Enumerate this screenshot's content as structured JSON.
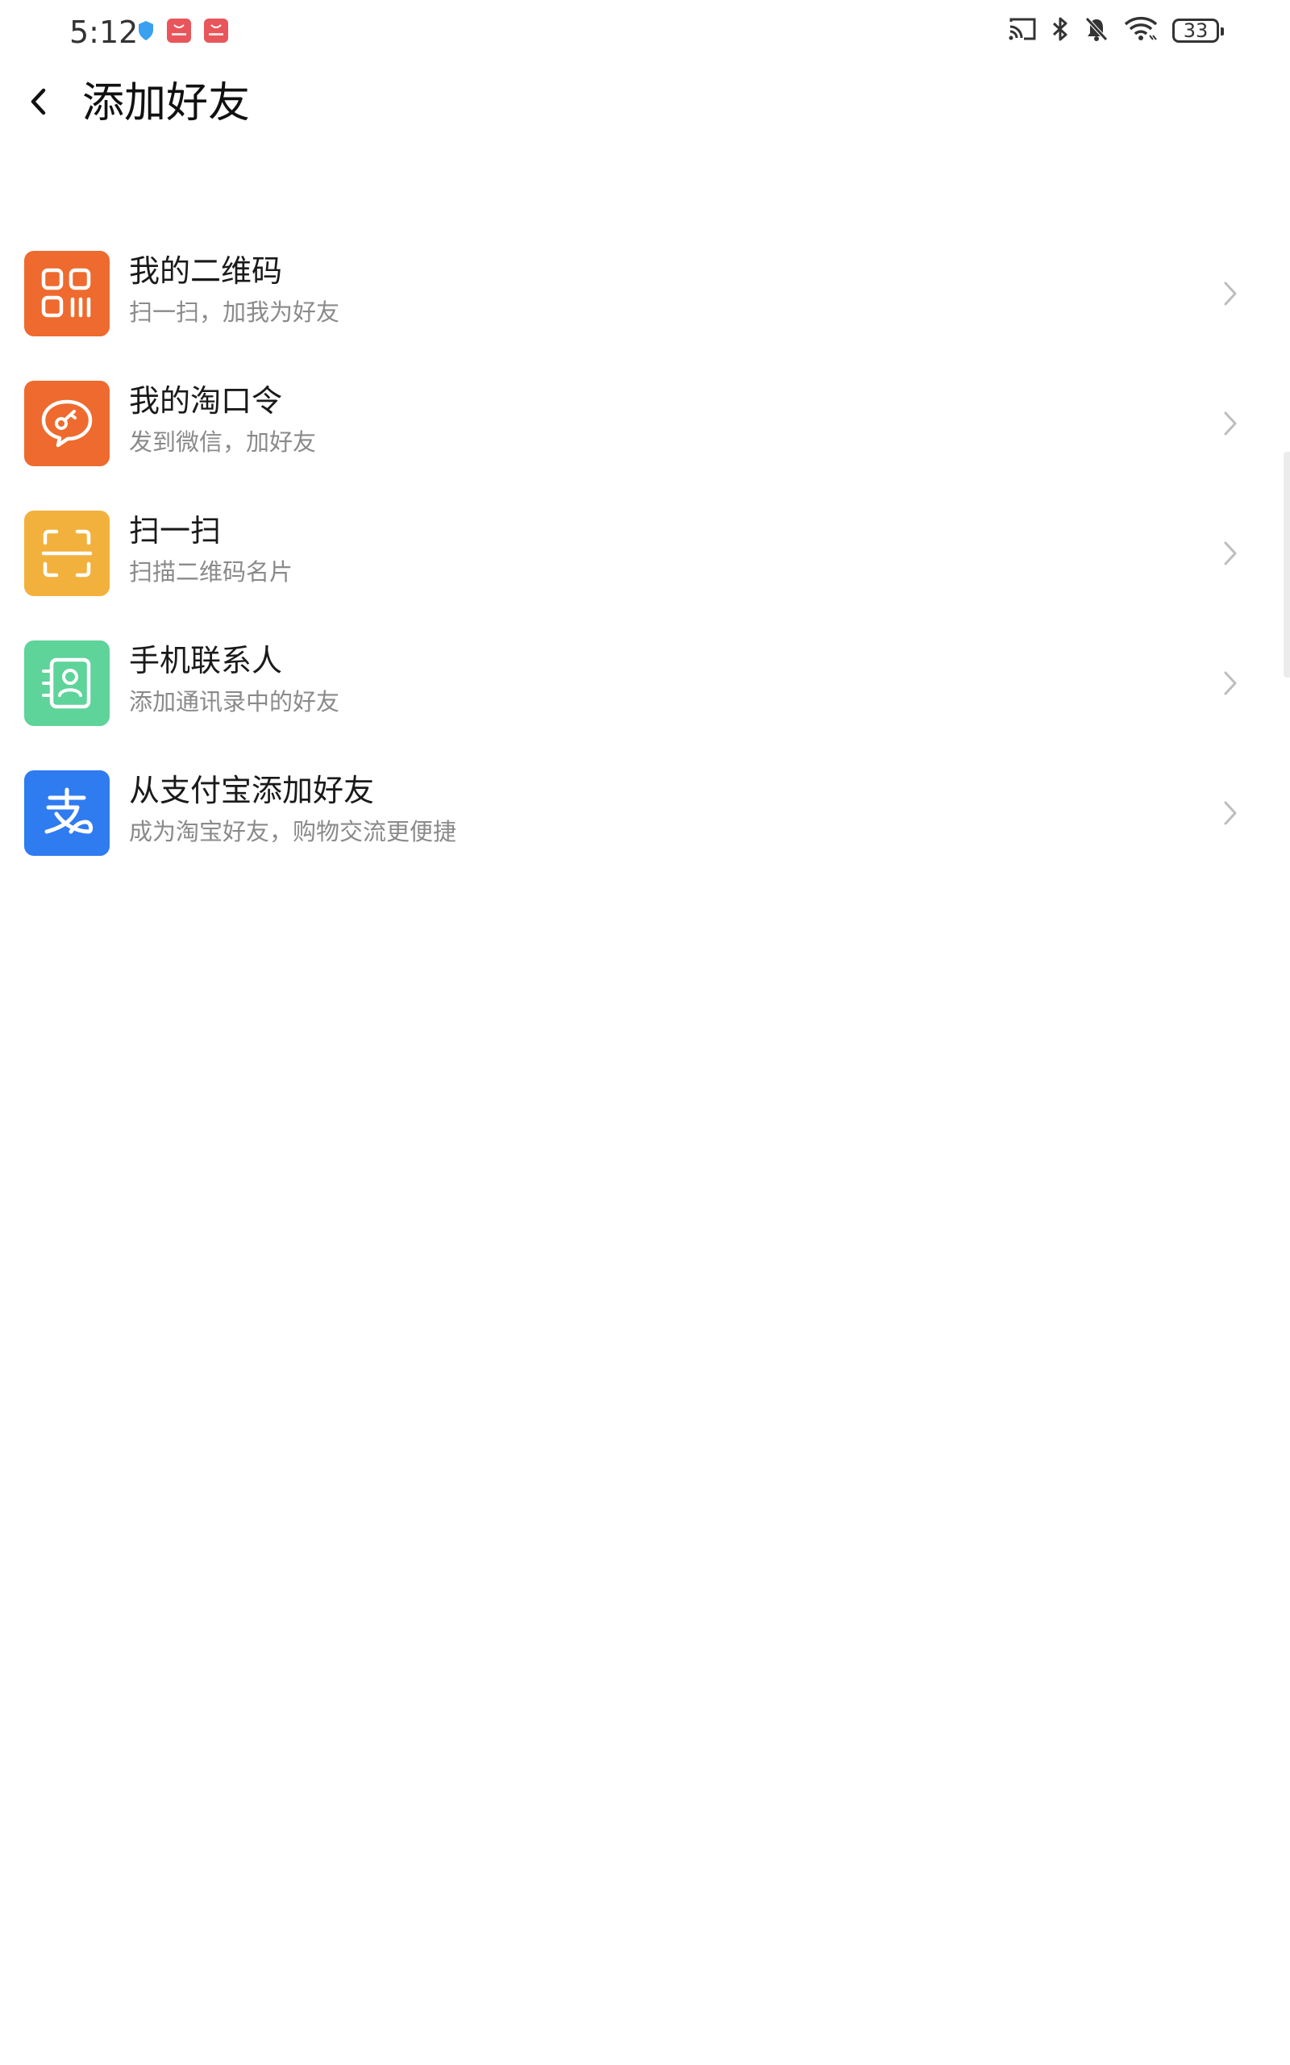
{
  "status_bar": {
    "time": "5:12",
    "battery_level": "33",
    "left_icons": [
      "shield-icon",
      "app-notification-icon",
      "app-notification-icon"
    ],
    "right_icons": [
      "cast-icon",
      "bluetooth-icon",
      "mute-icon",
      "wifi-icon",
      "battery-icon"
    ]
  },
  "header": {
    "title": "添加好友",
    "back_icon": "back-arrow-icon"
  },
  "menu": {
    "items": [
      {
        "title": "我的二维码",
        "subtitle": "扫一扫，加我为好友",
        "icon": "qr-code-icon",
        "color": "#EE6A2E"
      },
      {
        "title": "我的淘口令",
        "subtitle": "发到微信，加好友",
        "icon": "chat-key-icon",
        "color": "#EE6A2E"
      },
      {
        "title": "扫一扫",
        "subtitle": "扫描二维码名片",
        "icon": "scan-icon",
        "color": "#F2B13C"
      },
      {
        "title": "手机联系人",
        "subtitle": "添加通讯录中的好友",
        "icon": "contacts-icon",
        "color": "#5ED39A"
      },
      {
        "title": "从支付宝添加好友",
        "subtitle": "成为淘宝好友，购物交流更便捷",
        "icon": "alipay-icon",
        "color": "#2F7BF0"
      }
    ]
  },
  "colors": {
    "title_text": "#1a1a1a",
    "subtitle_text": "#8a8a8a",
    "chevron": "#bdbdbd",
    "app_badge": "#E8555A",
    "shield": "#3AA0F0"
  }
}
